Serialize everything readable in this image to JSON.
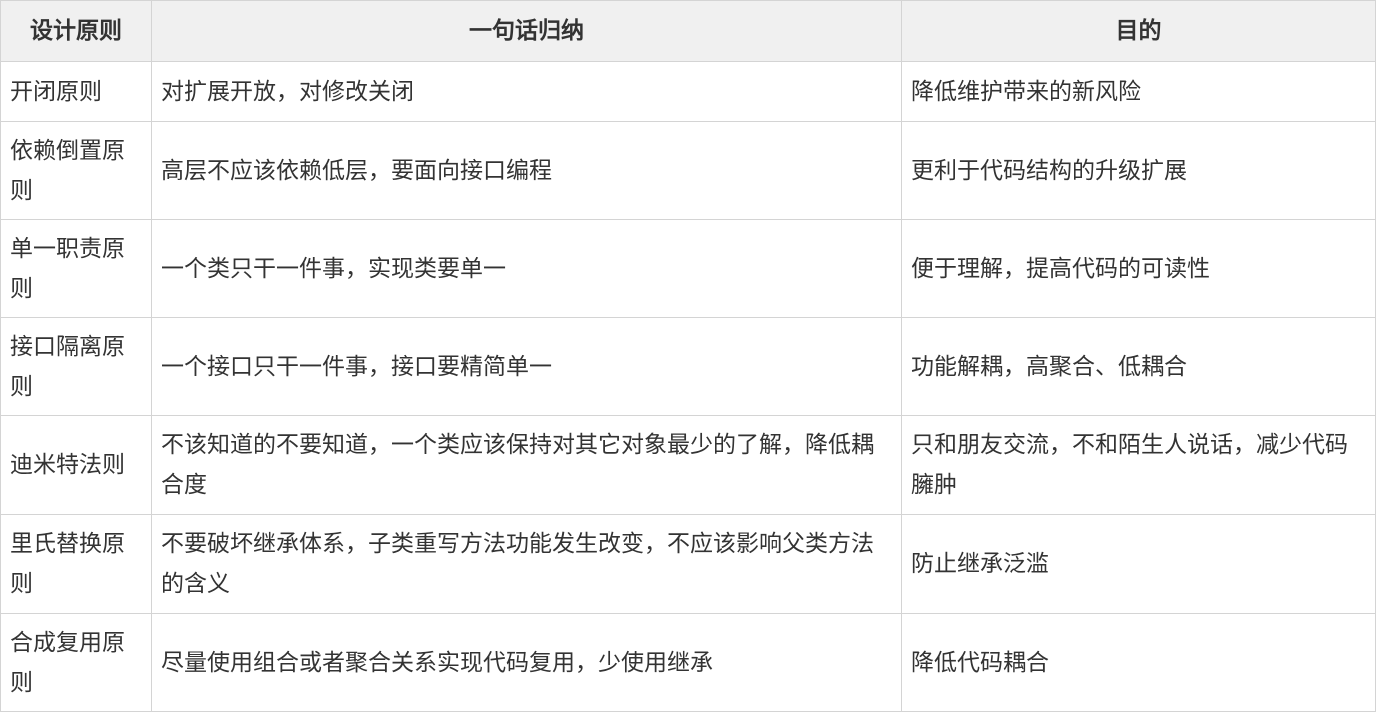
{
  "table": {
    "headers": [
      "设计原则",
      "一句话归纳",
      "目的"
    ],
    "rows": [
      [
        "开闭原则",
        "对扩展开放，对修改关闭",
        "降低维护带来的新风险"
      ],
      [
        "依赖倒置原则",
        "高层不应该依赖低层，要面向接口编程",
        "更利于代码结构的升级扩展"
      ],
      [
        "单一职责原则",
        "一个类只干一件事，实现类要单一",
        "便于理解，提高代码的可读性"
      ],
      [
        "接口隔离原则",
        "一个接口只干一件事，接口要精简单一",
        "功能解耦，高聚合、低耦合"
      ],
      [
        "迪米特法则",
        "不该知道的不要知道，一个类应该保持对其它对象最少的了解，降低耦合度",
        "只和朋友交流，不和陌生人说话，减少代码臃肿"
      ],
      [
        "里氏替换原则",
        "不要破坏继承体系，子类重写方法功能发生改变，不应该影响父类方法的含义",
        "防止继承泛滥"
      ],
      [
        "合成复用原则",
        "尽量使用组合或者聚合关系实现代码复用，少使用继承",
        "降低代码耦合"
      ]
    ]
  }
}
